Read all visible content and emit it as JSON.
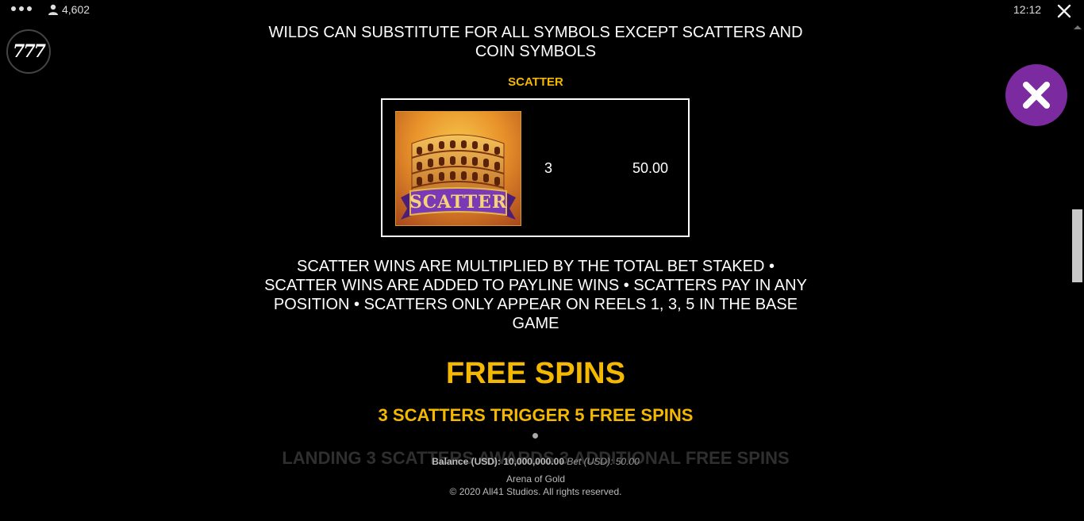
{
  "topbar": {
    "players_count": "4,602",
    "clock": "12:12"
  },
  "logo": {
    "text": "777"
  },
  "content": {
    "wilds_text": "WILDS CAN SUBSTITUTE FOR ALL SYMBOLS EXCEPT SCATTERS AND COIN SYMBOLS",
    "scatter_heading": "SCATTER",
    "scatter_symbol_label": "SCATTER",
    "paytable": {
      "count": "3",
      "value": "50.00"
    },
    "scatter_rules": "SCATTER WINS ARE MULTIPLIED BY THE TOTAL BET STAKED • SCATTER WINS ARE ADDED TO PAYLINE WINS • SCATTERS PAY IN ANY POSITION • SCATTERS ONLY APPEAR ON REELS 1, 3, 5 IN THE BASE GAME",
    "free_spins_title": "FREE SPINS",
    "free_spins_trigger": "3 SCATTERS TRIGGER 5 FREE SPINS",
    "faded_text": "LANDING 3 SCATTERS AWARDS 3 ADDITIONAL FREE SPINS"
  },
  "footer": {
    "balance_label": "Balance (USD):",
    "balance_value": "10,000,000.00",
    "bet_label": "Bet (USD):",
    "bet_value": "50.00",
    "game_name": "Arena of Gold",
    "copyright": "© 2020 All41 Studios. All rights reserved."
  },
  "colors": {
    "accent_gold": "#f5b800",
    "close_purple": "#7b2aa0",
    "background": "#000000"
  },
  "icons": [
    "menu-dots-icon",
    "user-icon",
    "close-icon",
    "big-close-icon",
    "scatter-symbol-icon"
  ]
}
